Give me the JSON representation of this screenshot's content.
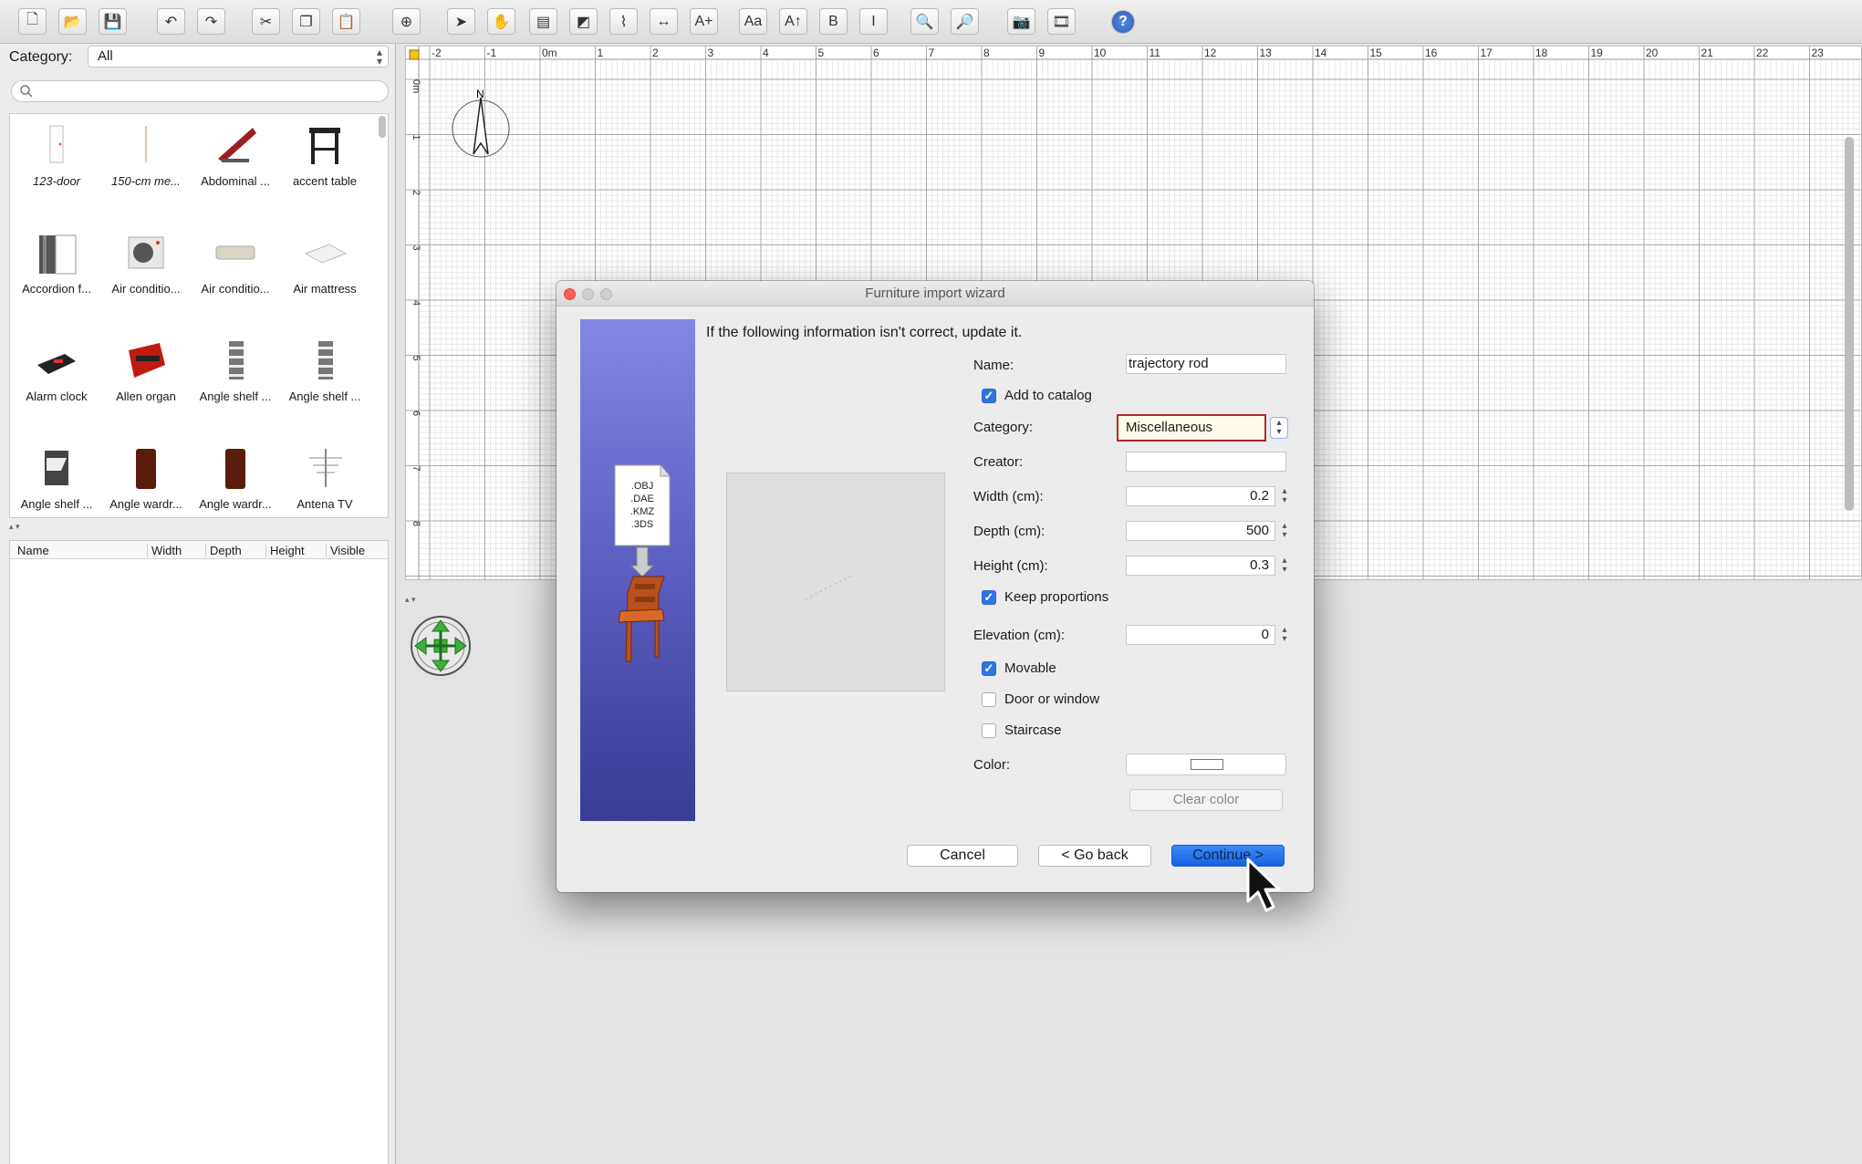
{
  "toolbar": {
    "buttons": [
      "new-icon",
      "open-icon",
      "save-icon",
      "undo-icon",
      "redo-icon",
      "cut-icon",
      "copy-icon",
      "paste-icon",
      "add-furniture-icon",
      "select-icon",
      "pan-icon",
      "create-walls-icon",
      "create-rooms-icon",
      "create-polylines-icon",
      "create-dimensions-icon",
      "add-text-icon",
      "modify-text-style-icon",
      "increase-text-size-icon",
      "bold-icon",
      "italic-icon",
      "zoom-in-icon",
      "zoom-out-icon",
      "create-photo-icon",
      "create-video-icon",
      "help-icon"
    ]
  },
  "catalog": {
    "category_label": "Category:",
    "category_value": "All",
    "search_placeholder": "",
    "items": [
      {
        "label": "123-door",
        "icon": "door-icon"
      },
      {
        "label": "150-cm me...",
        "icon": "measure-icon"
      },
      {
        "label": "Abdominal ...",
        "icon": "abdominal-bench-icon"
      },
      {
        "label": "accent table",
        "icon": "accent-table-icon"
      },
      {
        "label": "Accordion f...",
        "icon": "accordion-folding-door-icon"
      },
      {
        "label": "Air conditio...",
        "icon": "air-conditioner-outdoor-icon"
      },
      {
        "label": "Air conditio...",
        "icon": "air-conditioner-indoor-icon"
      },
      {
        "label": "Air mattress",
        "icon": "air-mattress-icon"
      },
      {
        "label": "Alarm clock",
        "icon": "alarm-clock-icon"
      },
      {
        "label": "Allen organ",
        "icon": "organ-icon"
      },
      {
        "label": "Angle shelf ...",
        "icon": "angle-shelf-icon"
      },
      {
        "label": "Angle shelf ...",
        "icon": "angle-shelf-icon"
      },
      {
        "label": "Angle shelf ...",
        "icon": "angle-shelf-icon"
      },
      {
        "label": "Angle wardr...",
        "icon": "angle-wardrobe-icon"
      },
      {
        "label": "Angle wardr...",
        "icon": "angle-wardrobe-icon"
      },
      {
        "label": "Antena TV",
        "icon": "tv-antenna-icon"
      }
    ]
  },
  "furniture_table": {
    "columns": [
      "Name",
      "Width",
      "Depth",
      "Height",
      "Visible"
    ]
  },
  "plan": {
    "ruler_labels": [
      "-2",
      "-1",
      "0m",
      "1",
      "2",
      "3",
      "4",
      "5",
      "6",
      "7",
      "8",
      "9",
      "10",
      "11",
      "12",
      "13",
      "14",
      "15",
      "16",
      "17",
      "18",
      "19",
      "20",
      "21",
      "22",
      "23"
    ],
    "vertical_labels": [
      "0m",
      "1",
      "2",
      "3",
      "4",
      "5",
      "6",
      "7",
      "8"
    ],
    "compass_label": "N"
  },
  "dialog": {
    "title": "Furniture import wizard",
    "message": "If the following information isn't correct, update it.",
    "banner_formats": [
      ".OBJ",
      ".DAE",
      ".KMZ",
      ".3DS"
    ],
    "name_label": "Name:",
    "name_value": "trajectory rod",
    "add_to_catalog_label": "Add to catalog",
    "add_to_catalog": true,
    "category_label": "Category:",
    "category_value": "Miscellaneous",
    "creator_label": "Creator:",
    "creator_value": "",
    "width_label": "Width (cm):",
    "width_value": "0.2",
    "depth_label": "Depth (cm):",
    "depth_value": "500",
    "height_label": "Height (cm):",
    "height_value": "0.3",
    "keep_proportions_label": "Keep proportions",
    "keep_proportions": true,
    "elevation_label": "Elevation (cm):",
    "elevation_value": "0",
    "movable_label": "Movable",
    "movable": true,
    "door_window_label": "Door or window",
    "door_window": false,
    "staircase_label": "Staircase",
    "staircase": false,
    "color_label": "Color:",
    "clear_color_label": "Clear color",
    "cancel_label": "Cancel",
    "back_label": "< Go back",
    "continue_label": "Continue >"
  },
  "colors": {
    "accent_blue": "#2e74e4",
    "focus_red": "#b3262a",
    "banner_top": "#8587e4",
    "banner_bottom": "#3a3b95"
  }
}
